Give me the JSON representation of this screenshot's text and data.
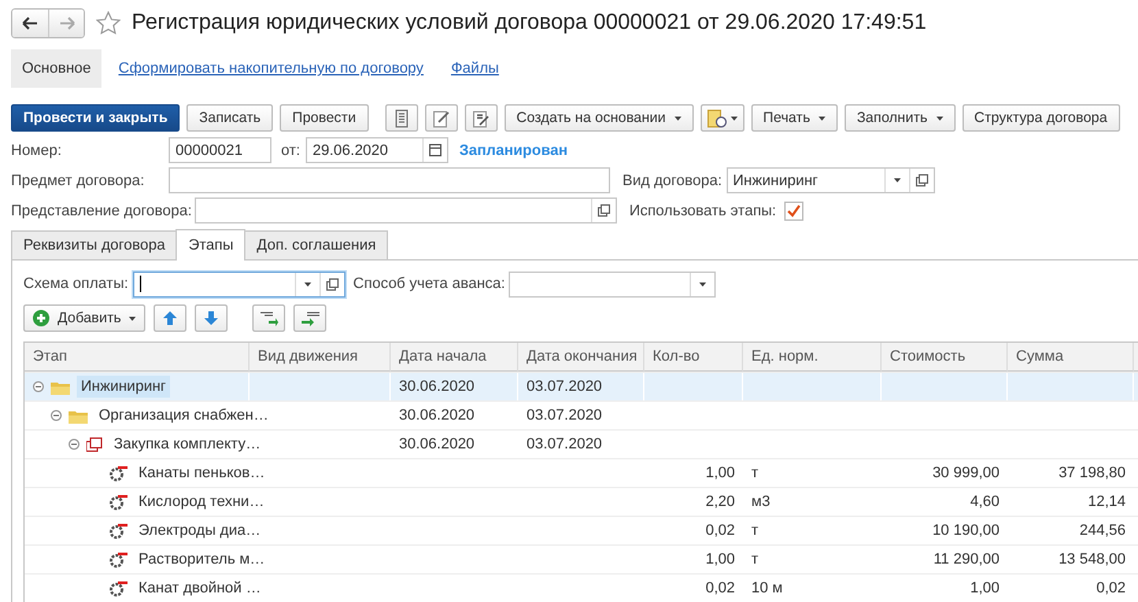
{
  "window": {
    "title": "Регистрация юридических условий договора 00000021 от 29.06.2020 17:49:51",
    "favorite": false
  },
  "sections": [
    {
      "label": "Основное",
      "selected": true
    },
    {
      "label": "Сформировать накопительную по договору",
      "selected": false
    },
    {
      "label": "Файлы",
      "selected": false
    }
  ],
  "toolbar": [
    {
      "kind": "primary",
      "label": "Провести и закрыть"
    },
    {
      "kind": "plain",
      "label": "Записать"
    },
    {
      "kind": "plain",
      "label": "Провести"
    },
    {
      "kind": "menu",
      "label": "Создать на основании"
    },
    {
      "kind": "menu",
      "label": "Печать"
    },
    {
      "kind": "menu",
      "label": "Заполнить"
    },
    {
      "kind": "plain",
      "label": "Структура договора"
    }
  ],
  "header": {
    "number_label": "Номер:",
    "number": "00000021",
    "date_label": "от:",
    "date": "29.06.2020",
    "status": "Запланирован",
    "subject_label": "Предмет договора:",
    "type_label": "Вид договора:",
    "type": "Инжиниринг",
    "title_label": "Представление договора:",
    "use_stages_label": "Использовать этапы:",
    "use_stages": true
  },
  "tabs": [
    {
      "label": "Реквизиты договора",
      "selected": false
    },
    {
      "label": "Этапы",
      "selected": true
    },
    {
      "label": "Доп. соглашения",
      "selected": false
    }
  ],
  "stages": {
    "scheme_label": "Схема оплаты:",
    "advance_label": "Способ учета аванса:",
    "add_button": "Добавить",
    "columns": [
      "Этап",
      "Вид движения",
      "Дата начала",
      "Дата окончания",
      "Кол-во",
      "Ед. норм.",
      "Стоимость",
      "Сумма"
    ],
    "rows": [
      {
        "kind": "folder",
        "stage": "Инжиниринг",
        "selected": true,
        "expanded": true,
        "start": "30.06.2020",
        "end": "03.07.2020",
        "children": [
          {
            "kind": "folder",
            "stage": "Организация снабжен…",
            "selected": false,
            "expanded": true,
            "start": "30.06.2020",
            "end": "03.07.2020",
            "children": [
              {
                "kind": "task",
                "stage": "Закупка комплекту…",
                "selected": false,
                "expanded": true,
                "start": "30.06.2020",
                "end": "03.07.2020",
                "children": [
                  {
                    "kind": "item",
                    "stage": "Канаты пеньков…",
                    "selected": false,
                    "qty": "1,00",
                    "unit": "т",
                    "cost": "30 999,00",
                    "sum": "37 198,80"
                  },
                  {
                    "kind": "item",
                    "stage": "Кислород техни…",
                    "selected": false,
                    "qty": "2,20",
                    "unit": "м3",
                    "cost": "4,60",
                    "sum": "12,14"
                  },
                  {
                    "kind": "item",
                    "stage": "Электроды диа…",
                    "selected": false,
                    "qty": "0,02",
                    "unit": "т",
                    "cost": "10 190,00",
                    "sum": "244,56"
                  },
                  {
                    "kind": "item",
                    "stage": "Растворитель м…",
                    "selected": false,
                    "qty": "1,00",
                    "unit": "т",
                    "cost": "11 290,00",
                    "sum": "13 548,00"
                  },
                  {
                    "kind": "item",
                    "stage": "Канат двойной …",
                    "selected": false,
                    "qty": "0,02",
                    "unit": "10 м",
                    "cost": "1,00",
                    "sum": "0,02"
                  }
                ]
              }
            ]
          }
        ]
      }
    ]
  }
}
